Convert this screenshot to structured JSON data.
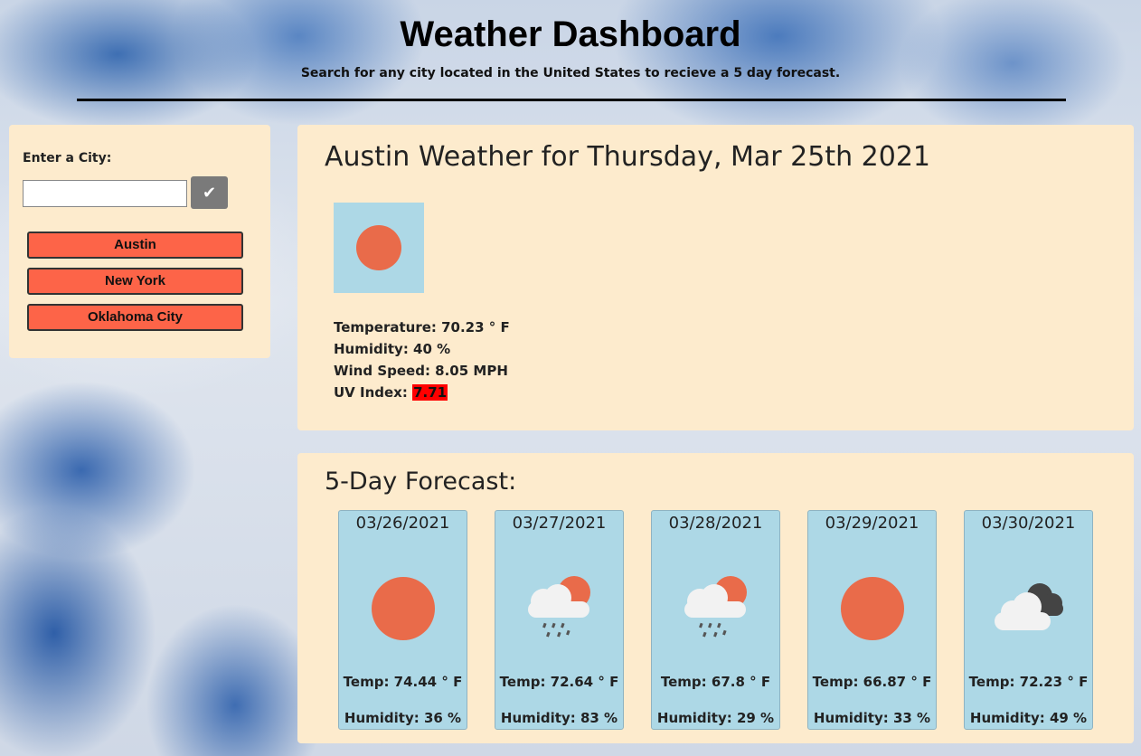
{
  "header": {
    "title": "Weather Dashboard",
    "subtitle": "Search for any city located in the United States to recieve a 5 day forecast."
  },
  "search": {
    "label": "Enter a City:",
    "input_value": "",
    "button_icon": "checkmark-icon",
    "history": [
      "Austin",
      "New York",
      "Oklahoma City"
    ]
  },
  "current": {
    "title": "Austin Weather for Thursday, Mar 25th 2021",
    "icon": "sun-icon",
    "temperature": "Temperature: 70.23 ° F",
    "humidity": "Humidity: 40 %",
    "wind": "Wind Speed: 8.05 MPH",
    "uv_label": "UV Index: ",
    "uv_value": "7.71",
    "uv_color": "#ff0000"
  },
  "forecast": {
    "title": "5-Day Forecast:",
    "days": [
      {
        "date": "03/26/2021",
        "icon": "sun-icon",
        "temp": "Temp: 74.44 ° F",
        "humidity": "Humidity: 36 %"
      },
      {
        "date": "03/27/2021",
        "icon": "rain-cloud-sun-icon",
        "temp": "Temp: 72.64 ° F",
        "humidity": "Humidity: 83 %"
      },
      {
        "date": "03/28/2021",
        "icon": "rain-cloud-sun-icon",
        "temp": "Temp: 67.8 ° F",
        "humidity": "Humidity: 29 %"
      },
      {
        "date": "03/29/2021",
        "icon": "sun-icon",
        "temp": "Temp: 66.87 ° F",
        "humidity": "Humidity: 33 %"
      },
      {
        "date": "03/30/2021",
        "icon": "clouds-icon",
        "temp": "Temp: 72.23 ° F",
        "humidity": "Humidity: 49 %"
      }
    ]
  },
  "colors": {
    "panel": "#fdebcd",
    "card": "#add8e6",
    "city_button": "#fd6448",
    "sun": "#e96b4a"
  }
}
